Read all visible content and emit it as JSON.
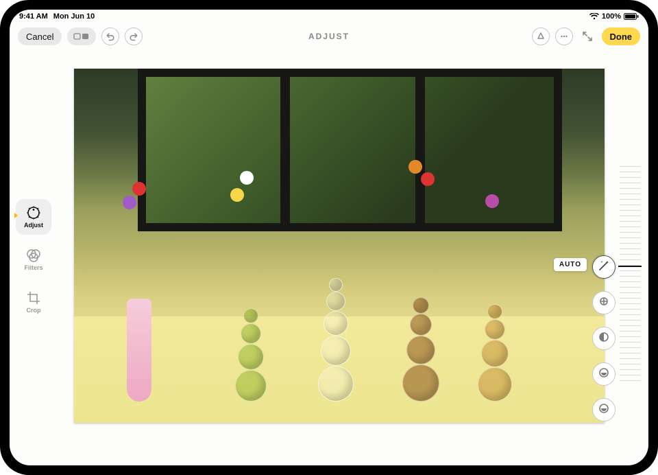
{
  "status": {
    "time": "9:41 AM",
    "date": "Mon Jun 10",
    "battery_pct": "100%"
  },
  "toolbar": {
    "cancel_label": "Cancel",
    "title": "ADJUST",
    "done_label": "Done"
  },
  "sidebar": {
    "adjust_label": "Adjust",
    "filters_label": "Filters",
    "crop_label": "Crop"
  },
  "adjust": {
    "auto_label": "AUTO",
    "tools": [
      {
        "id": "auto",
        "name": "magic-wand-icon",
        "active": true
      },
      {
        "id": "exposure",
        "name": "exposure-icon",
        "active": false
      },
      {
        "id": "brilliance",
        "name": "brilliance-icon",
        "active": false
      },
      {
        "id": "highlights",
        "name": "highlights-icon",
        "active": false
      },
      {
        "id": "shadows",
        "name": "shadows-icon",
        "active": false
      }
    ]
  },
  "colors": {
    "accent": "#ffd84d",
    "tick": "#ffb400"
  }
}
